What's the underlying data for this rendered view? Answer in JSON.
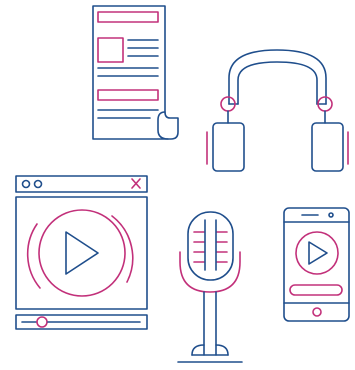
{
  "illustration": {
    "items": [
      {
        "id": "newspaper",
        "icon": "newspaper-icon"
      },
      {
        "id": "headphones",
        "icon": "headphones-icon"
      },
      {
        "id": "media-player-window",
        "icon": "media-player-window-icon"
      },
      {
        "id": "microphone",
        "icon": "microphone-icon"
      },
      {
        "id": "smartphone-player",
        "icon": "smartphone-player-icon"
      }
    ],
    "colors": {
      "outline": "#1f4e8c",
      "accent": "#c2307a",
      "background": "#ffffff"
    }
  }
}
